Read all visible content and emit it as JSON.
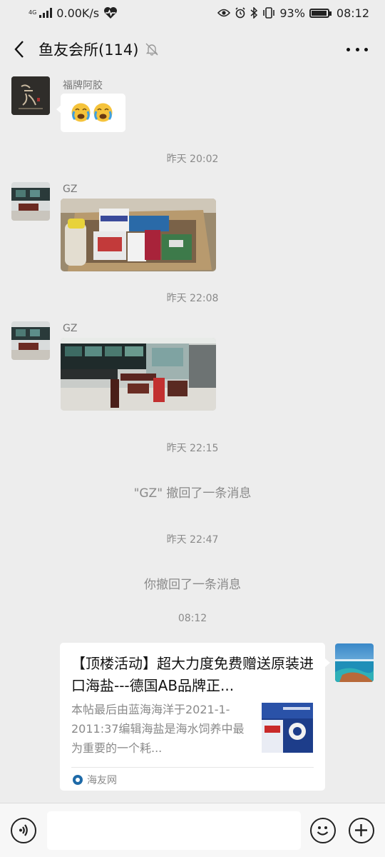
{
  "status": {
    "network_tag": "4G",
    "speed": "0.00K/s",
    "battery": "93%",
    "time": "08:12"
  },
  "header": {
    "title": "鱼友会所(114)"
  },
  "messages": {
    "m1_sender": "福牌阿胶",
    "m1_emoji": "😭😭",
    "ts1": "昨天 20:02",
    "m2_sender": "GZ",
    "ts2": "昨天 22:08",
    "m3_sender": "GZ",
    "ts3": "昨天 22:15",
    "recall1": "\"GZ\" 撤回了一条消息",
    "ts4": "昨天 22:47",
    "recall2": "你撤回了一条消息",
    "ts5": "08:12"
  },
  "card": {
    "title": "【顶楼活动】超大力度免费赠送原装进口海盐---德国AB品牌正...",
    "desc": "本帖最后由蓝海海洋于2021-1-2011:37编辑海盐是海水饲养中最为重要的一个耗...",
    "source": "海友网"
  },
  "input": {
    "placeholder": ""
  }
}
